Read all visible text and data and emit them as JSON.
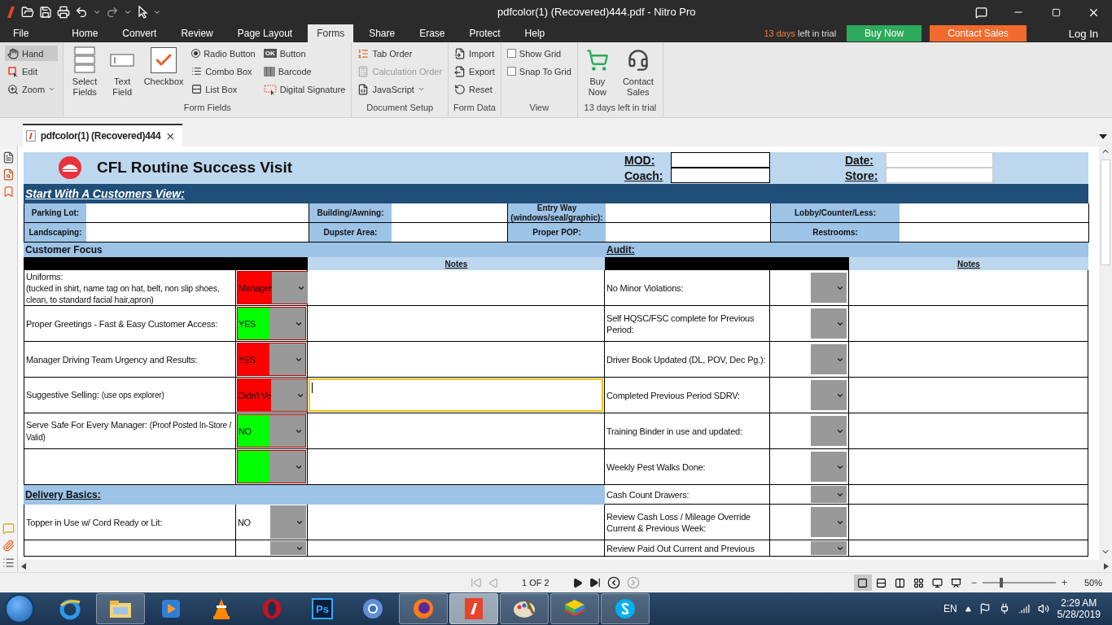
{
  "window": {
    "title": "pdfcolor(1) (Recovered)444.pdf - Nitro Pro"
  },
  "menu": {
    "tabs": [
      {
        "label": "File",
        "selected": false
      },
      {
        "label": "Home",
        "selected": false
      },
      {
        "label": "Convert",
        "selected": false
      },
      {
        "label": "Review",
        "selected": false
      },
      {
        "label": "Page Layout",
        "selected": false
      },
      {
        "label": "Forms",
        "selected": true
      },
      {
        "label": "Share",
        "selected": false
      },
      {
        "label": "Erase",
        "selected": false
      },
      {
        "label": "Protect",
        "selected": false
      },
      {
        "label": "Help",
        "selected": false
      }
    ],
    "trial_days": "13 days",
    "trial_rest": "left in trial",
    "buy": "Buy Now",
    "contact": "Contact Sales",
    "login": "Log In"
  },
  "ribbon": {
    "tools": [
      {
        "label": "Hand",
        "selected": true
      },
      {
        "label": "Edit",
        "selected": false
      },
      {
        "label": "Zoom",
        "selected": false
      }
    ],
    "form_fields": {
      "label": "Form Fields",
      "button_icon_text": "OK",
      "items": [
        "Select Fields",
        "Text Field",
        "Checkbox",
        "Radio Button",
        "Combo Box",
        "List Box",
        "Button",
        "Barcode",
        "Digital Signature"
      ]
    },
    "document_setup": {
      "label": "Document Setup",
      "items": [
        {
          "label": "Tab Order",
          "disabled": false
        },
        {
          "label": "Calculation Order",
          "disabled": true
        },
        {
          "label": "JavaScript",
          "disabled": false
        }
      ]
    },
    "form_data": {
      "label": "Form Data",
      "items": [
        "Import",
        "Export",
        "Reset"
      ]
    },
    "view": {
      "label": "View",
      "options": [
        {
          "label": "Show Grid",
          "checked": false
        },
        {
          "label": "Snap To Grid",
          "checked": false
        }
      ]
    },
    "trial": {
      "label": "13 days left in trial",
      "items": [
        "Buy Now",
        "Contact Sales"
      ]
    }
  },
  "doc_tab": {
    "label": "pdfcolor(1) (Recovered)444"
  },
  "form": {
    "title": "CFL Routine Success Visit",
    "header_fields": [
      {
        "label": "MOD:"
      },
      {
        "label": "Coach:"
      },
      {
        "label": "Date:"
      },
      {
        "label": "Store:"
      }
    ],
    "banner": "Start With A Customers View:",
    "view_fields": [
      {
        "label": "Parking Lot:"
      },
      {
        "label": "Building/Awning:"
      },
      {
        "label": "Entry Way\n(windows/seal/graphic):"
      },
      {
        "label": "Lobby/Counter/Less:"
      },
      {
        "label": "Landscaping:"
      },
      {
        "label": "Dupster Area:"
      },
      {
        "label": "Proper POP:"
      },
      {
        "label": "Restrooms:"
      }
    ],
    "rows": [
      {
        "left": {
          "kind": "section",
          "label": "Customer Focus",
          "underlined": false
        },
        "right": {
          "kind": "section",
          "label": "Audit:",
          "underlined": true
        }
      },
      {
        "left": {
          "kind": "notes-header",
          "label": "Notes"
        },
        "right": {
          "kind": "notes-header",
          "label": "Notes"
        }
      },
      {
        "left": {
          "kind": "item",
          "label": "Uniforms:",
          "detail": "(tucked in shirt, name tag on hat, belt, non slip shoes, clean, to standard facial hair,apron)",
          "detail_block": true,
          "value": "Manager",
          "color": "#ff0000",
          "focused": false
        },
        "right": {
          "kind": "item",
          "label": "No Minor Violations:",
          "focused": false
        }
      },
      {
        "left": {
          "kind": "item",
          "label": "Proper Greetings - Fast & Easy Customer Access:",
          "value": "YES",
          "color": "#00ff00",
          "focused": false
        },
        "right": {
          "kind": "item",
          "label": "Self HQSC/FSC complete for Previous Period:",
          "focused": false
        }
      },
      {
        "left": {
          "kind": "item",
          "label": "Manager Driving Team Urgency and Results:",
          "value": "YES",
          "color": "#ff0000",
          "focused": false
        },
        "right": {
          "kind": "item",
          "label": "Driver Book Updated (DL, POV, Dec Pg.):",
          "focused": false
        }
      },
      {
        "left": {
          "kind": "item",
          "label": "Suggestive Selling:",
          "detail": "(use ops explorer)",
          "value": "Didn't Ve",
          "color": "#ff0000",
          "focused": true
        },
        "right": {
          "kind": "item",
          "label": "Completed Previous Period SDRV:",
          "focused": false
        }
      },
      {
        "left": {
          "kind": "item",
          "label": "Serve Safe For Every Manager:",
          "detail": "(Proof Posted In-Store / Valid)",
          "value": "NO",
          "color": "#00ff00",
          "focused": false
        },
        "right": {
          "kind": "item",
          "label": "Training Binder in use and updated:",
          "focused": false
        }
      },
      {
        "left": {
          "kind": "item",
          "color": "#00ff00",
          "focused": false
        },
        "right": {
          "kind": "item",
          "label": "Weekly Pest Walks Done:",
          "focused": false
        }
      },
      {
        "left": {
          "kind": "section",
          "label": "Delivery Basics:",
          "underlined": true
        },
        "right": {
          "kind": "item",
          "label": "Cash Count Drawers:",
          "focused": false
        }
      },
      {
        "left": {
          "kind": "item",
          "label": "Topper in Use w/ Cord Ready or Lit:",
          "value": "NO",
          "focused": false
        },
        "right": {
          "kind": "item",
          "label": "Review Cash Loss / Mileage Override Current & Previous Week:",
          "focused": false
        }
      },
      {
        "left": {
          "kind": "item",
          "focused": false
        },
        "right": {
          "kind": "item",
          "label": "Review Paid Out Current and Previous",
          "focused": false
        }
      }
    ]
  },
  "nav": {
    "page": "1 OF 2",
    "views": [
      {
        "selected": true
      },
      {
        "selected": false
      },
      {
        "selected": false
      },
      {
        "selected": false
      },
      {
        "selected": false
      },
      {
        "selected": false
      }
    ],
    "zoom_minus": "−",
    "zoom_plus": "+",
    "zoom_slider": {
      "level": 0.25
    },
    "zoom": "50%"
  },
  "taskbar": {
    "apps": [
      {
        "kind": "ie",
        "open": false,
        "selected": false
      },
      {
        "kind": "explorer",
        "open": true,
        "selected": false
      },
      {
        "kind": "media",
        "open": false,
        "selected": false
      },
      {
        "kind": "vlc",
        "open": false,
        "selected": false
      },
      {
        "kind": "opera",
        "open": false,
        "selected": false
      },
      {
        "kind": "photoshop",
        "label": "Ps",
        "open": false,
        "selected": false
      },
      {
        "kind": "chrome",
        "open": false,
        "selected": false
      },
      {
        "kind": "firefox",
        "open": true,
        "selected": false
      },
      {
        "kind": "nitro",
        "open": true,
        "selected": true
      },
      {
        "kind": "paint",
        "open": true,
        "selected": false
      },
      {
        "kind": "bluestacks",
        "open": true,
        "selected": false
      },
      {
        "kind": "skype",
        "open": true,
        "selected": false
      }
    ],
    "lang": "EN",
    "time": "2:29 AM",
    "date": "5/28/2019"
  }
}
